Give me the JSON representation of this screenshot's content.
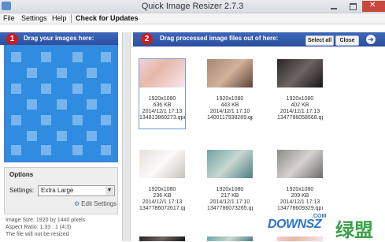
{
  "window": {
    "title": "Quick Image Resizer 2.7.3"
  },
  "menu": [
    "File",
    "Settings",
    "Help",
    "Check for Updates"
  ],
  "left_panel": {
    "step": "1",
    "header": "Drag your images here:",
    "options_title": "Options",
    "settings_label": "Settings:",
    "settings_value": "Extra Large",
    "edit_settings": "Edit Settings",
    "info": [
      "Image Size: 1920 by 1440 pixels",
      "Aspect Ratio: 1.33 : 1 (4:3)",
      "The file will not be resized"
    ]
  },
  "right_panel": {
    "step": "2",
    "header": "Drag processed image files out of here:",
    "select_all": "Select all",
    "close": "Close"
  },
  "thumbnails": [
    {
      "dims": "1920x1080",
      "size": "636 KB",
      "date": "2014/12/1 17:13",
      "name": "134813860273.qpr",
      "tone": "pink"
    },
    {
      "dims": "1920x1080",
      "size": "443 KB",
      "date": "2014/12/1 17:10",
      "name": "1400117938289.qpr",
      "tone": "warm"
    },
    {
      "dims": "1920x1080",
      "size": "402 KB",
      "date": "2014/12/1 17:13",
      "name": "1347786058568.qpr",
      "tone": "dark"
    },
    {
      "dims": "1920x1080",
      "size": "236 KB",
      "date": "2014/12/1 17:13",
      "name": "1347786072617.qpr",
      "tone": "light"
    },
    {
      "dims": "1920x1080",
      "size": "217 KB",
      "date": "2014/12/1 17:10",
      "name": "1347786073265.qpr",
      "tone": "teal"
    },
    {
      "dims": "1920x1080",
      "size": "209 KB",
      "date": "2014/12/1 17:13",
      "name": "134778609329.qpr",
      "tone": "grey"
    },
    {
      "dims": "",
      "size": "",
      "date": "",
      "name": "",
      "tone": "dark"
    },
    {
      "dims": "",
      "size": "",
      "date": "",
      "name": "",
      "tone": "teal"
    },
    {
      "dims": "",
      "size": "",
      "date": "",
      "name": "",
      "tone": "pink"
    }
  ],
  "watermark": {
    "text": "DOWNSZ",
    "cn": "绿盟",
    "com": ".COM"
  },
  "colors": {
    "header": "#2f58a8",
    "dropzone": "#2f8ce0",
    "badge": "#c62020"
  }
}
